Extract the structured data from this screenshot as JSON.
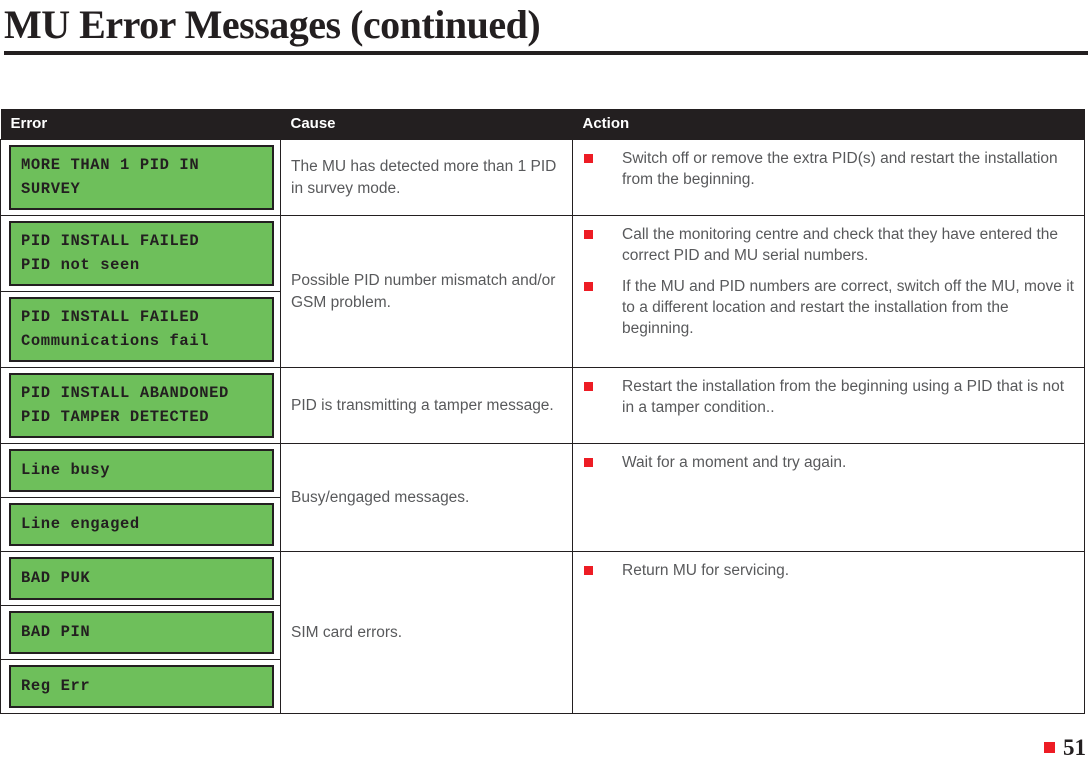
{
  "header": {
    "title": "MU Error Messages (continued)"
  },
  "table": {
    "columns": [
      "Error",
      "Cause",
      "Action"
    ],
    "rows": [
      {
        "displays": [
          {
            "lines": "MORE THAN 1 PID IN\nSURVEY"
          }
        ],
        "cause": "The MU has detected more than 1 PID in survey mode.",
        "actions": [
          "Switch off or remove the extra PID(s) and restart the installation from the beginning."
        ]
      },
      {
        "displays": [
          {
            "lines": "PID INSTALL FAILED\nPID not seen"
          },
          {
            "lines": "PID INSTALL FAILED\nCommunications fail"
          }
        ],
        "cause": "Possible PID number mismatch and/or GSM problem.",
        "actions": [
          "Call the monitoring centre and check that they have entered the correct PID and MU serial numbers.",
          "If the MU and PID numbers are correct, switch off the MU, move it to a different location and restart the installation from the beginning."
        ]
      },
      {
        "displays": [
          {
            "lines": "PID INSTALL ABANDONED\nPID TAMPER DETECTED"
          }
        ],
        "cause": "PID is transmitting a tamper message.",
        "actions": [
          "Restart the installation from the beginning using a PID that is not in a tamper condition.."
        ]
      },
      {
        "displays": [
          {
            "lines": "Line busy"
          },
          {
            "lines": "Line engaged"
          }
        ],
        "cause": "Busy/engaged messages.",
        "actions": [
          "Wait for a moment and try again."
        ]
      },
      {
        "displays": [
          {
            "lines": "BAD PUK"
          },
          {
            "lines": "BAD PIN"
          },
          {
            "lines": "Reg Err"
          }
        ],
        "cause": "SIM card errors.",
        "actions": [
          "Return MU for servicing."
        ]
      }
    ]
  },
  "footer": {
    "page_number": "51"
  },
  "colors": {
    "lcd_green": "#6ebf5b",
    "bullet_red": "#ed1c24",
    "header_black": "#231f20",
    "body_gray": "#58595b"
  }
}
